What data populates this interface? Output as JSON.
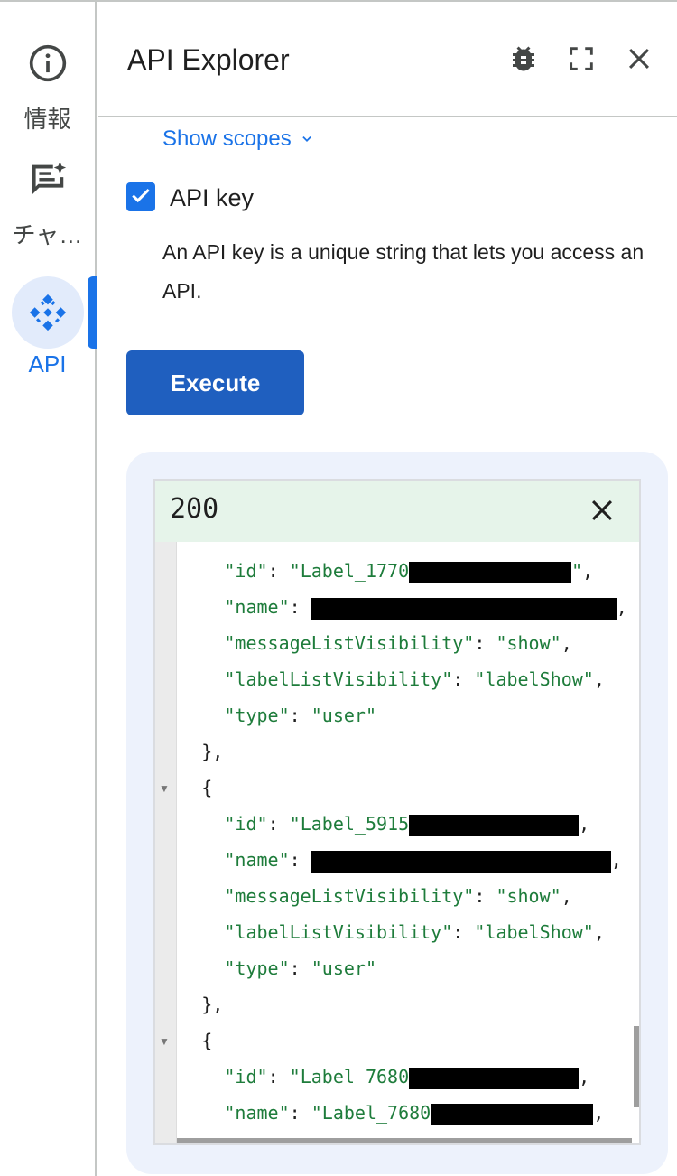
{
  "rail": {
    "items": [
      {
        "id": "info",
        "label": "情報"
      },
      {
        "id": "chat",
        "label": "チャ…"
      },
      {
        "id": "api",
        "label": "API"
      }
    ]
  },
  "header": {
    "title": "API Explorer"
  },
  "request": {
    "show_scopes": "Show scopes",
    "api_key_label": "API key",
    "api_key_checked": true,
    "api_key_desc": "An API key is a unique string that lets you access an API.",
    "execute_label": "Execute"
  },
  "response": {
    "status": "200",
    "lines": [
      {
        "indent": 4,
        "parts": [
          {
            "t": "k",
            "v": "\"id\""
          },
          {
            "t": "p",
            "v": ": "
          },
          {
            "t": "s",
            "v": "\"Label_1770"
          },
          {
            "t": "r",
            "w": 180
          },
          {
            "t": "s",
            "v": "\""
          },
          {
            "t": "p",
            "v": ","
          }
        ]
      },
      {
        "indent": 4,
        "parts": [
          {
            "t": "k",
            "v": "\"name\""
          },
          {
            "t": "p",
            "v": ": "
          },
          {
            "t": "r",
            "w": 338
          },
          {
            "t": "p",
            "v": ","
          }
        ]
      },
      {
        "indent": 4,
        "parts": [
          {
            "t": "k",
            "v": "\"messageListVisibility\""
          },
          {
            "t": "p",
            "v": ": "
          },
          {
            "t": "s",
            "v": "\"show\""
          },
          {
            "t": "p",
            "v": ","
          }
        ]
      },
      {
        "indent": 4,
        "parts": [
          {
            "t": "k",
            "v": "\"labelListVisibility\""
          },
          {
            "t": "p",
            "v": ": "
          },
          {
            "t": "s",
            "v": "\"labelShow\""
          },
          {
            "t": "p",
            "v": ","
          }
        ]
      },
      {
        "indent": 4,
        "parts": [
          {
            "t": "k",
            "v": "\"type\""
          },
          {
            "t": "p",
            "v": ": "
          },
          {
            "t": "s",
            "v": "\"user\""
          }
        ]
      },
      {
        "indent": 2,
        "parts": [
          {
            "t": "p",
            "v": "},"
          }
        ]
      },
      {
        "indent": 2,
        "fold": true,
        "parts": [
          {
            "t": "p",
            "v": "{"
          }
        ]
      },
      {
        "indent": 4,
        "parts": [
          {
            "t": "k",
            "v": "\"id\""
          },
          {
            "t": "p",
            "v": ": "
          },
          {
            "t": "s",
            "v": "\"Label_5915"
          },
          {
            "t": "r",
            "w": 188
          },
          {
            "t": "p",
            "v": ","
          }
        ]
      },
      {
        "indent": 4,
        "parts": [
          {
            "t": "k",
            "v": "\"name\""
          },
          {
            "t": "p",
            "v": ": "
          },
          {
            "t": "r",
            "w": 332
          },
          {
            "t": "p",
            "v": ","
          }
        ]
      },
      {
        "indent": 4,
        "parts": [
          {
            "t": "k",
            "v": "\"messageListVisibility\""
          },
          {
            "t": "p",
            "v": ": "
          },
          {
            "t": "s",
            "v": "\"show\""
          },
          {
            "t": "p",
            "v": ","
          }
        ]
      },
      {
        "indent": 4,
        "parts": [
          {
            "t": "k",
            "v": "\"labelListVisibility\""
          },
          {
            "t": "p",
            "v": ": "
          },
          {
            "t": "s",
            "v": "\"labelShow\""
          },
          {
            "t": "p",
            "v": ","
          }
        ]
      },
      {
        "indent": 4,
        "parts": [
          {
            "t": "k",
            "v": "\"type\""
          },
          {
            "t": "p",
            "v": ": "
          },
          {
            "t": "s",
            "v": "\"user\""
          }
        ]
      },
      {
        "indent": 2,
        "parts": [
          {
            "t": "p",
            "v": "},"
          }
        ]
      },
      {
        "indent": 2,
        "fold": true,
        "parts": [
          {
            "t": "p",
            "v": "{"
          }
        ]
      },
      {
        "indent": 4,
        "parts": [
          {
            "t": "k",
            "v": "\"id\""
          },
          {
            "t": "p",
            "v": ": "
          },
          {
            "t": "s",
            "v": "\"Label_7680"
          },
          {
            "t": "r",
            "w": 188
          },
          {
            "t": "p",
            "v": ","
          }
        ]
      },
      {
        "indent": 4,
        "parts": [
          {
            "t": "k",
            "v": "\"name\""
          },
          {
            "t": "p",
            "v": ": "
          },
          {
            "t": "s",
            "v": "\"Label_7680"
          },
          {
            "t": "r",
            "w": 180
          },
          {
            "t": "p",
            "v": ","
          }
        ]
      }
    ]
  },
  "icons": {
    "info": "info-icon",
    "chat": "chat-spark-icon",
    "api": "api-diamond-icon",
    "debug": "bug-icon",
    "fullscreen": "fullscreen-icon",
    "close": "close-icon",
    "checkbox": "check-icon",
    "chevron": "chevron-down-icon"
  },
  "colors": {
    "accent": "#1a73e8",
    "execute_bg": "#1f5fbf",
    "success_bg": "#e6f4ea",
    "json_key": "#1e7c3b",
    "card_bg": "#edf2fc"
  }
}
